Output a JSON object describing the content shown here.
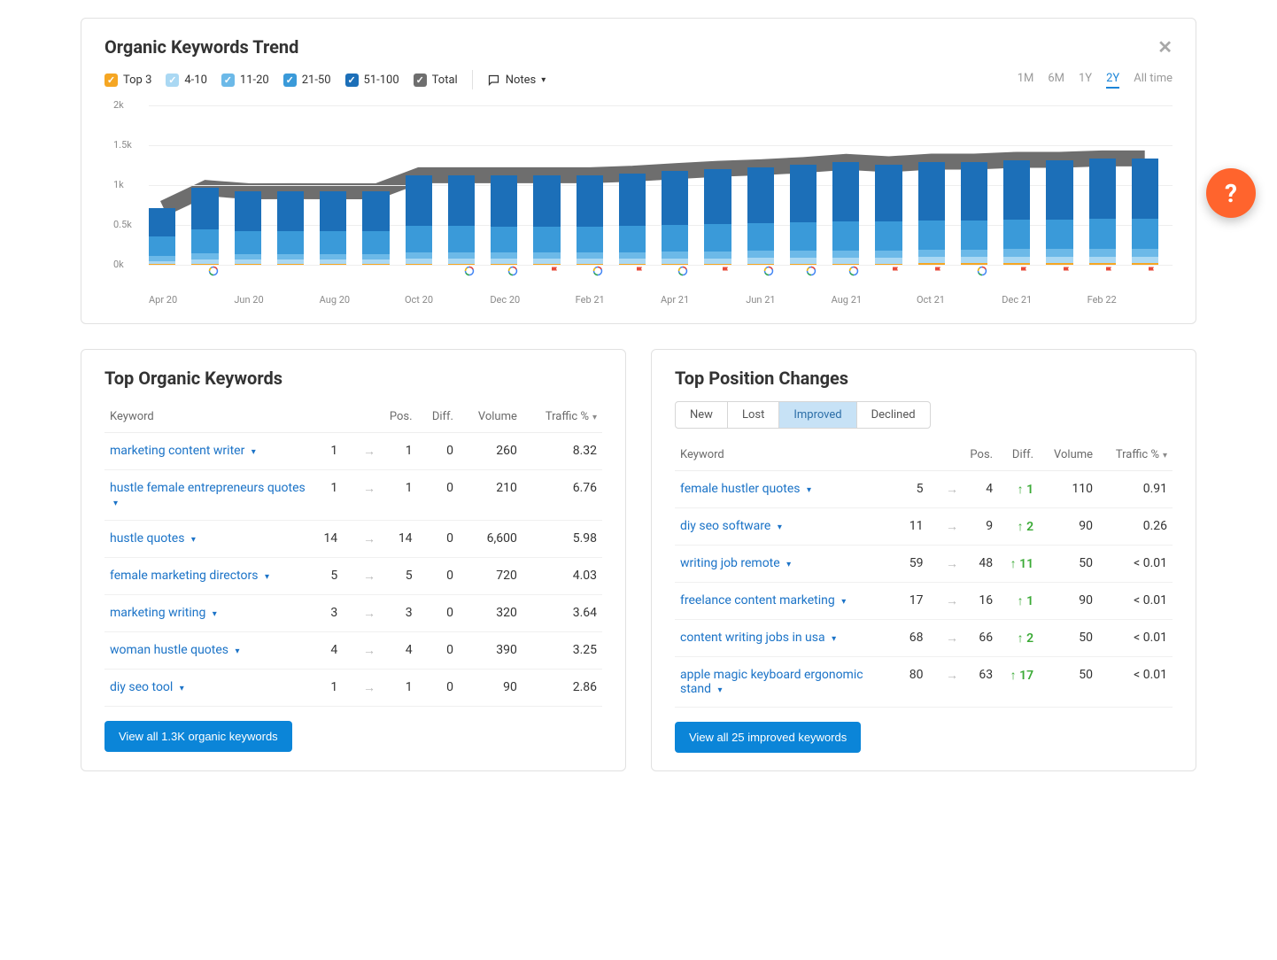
{
  "trend_card": {
    "title": "Organic Keywords Trend",
    "legend": {
      "top3": "Top 3",
      "r1": "4-10",
      "r2": "11-20",
      "r3": "21-50",
      "r4": "51-100",
      "total": "Total"
    },
    "notes_label": "Notes",
    "ranges": {
      "m1": "1M",
      "m6": "6M",
      "y1": "1Y",
      "y2": "2Y",
      "all": "All time"
    },
    "selected_range": "2Y"
  },
  "chart_data": {
    "type": "bar",
    "title": "Organic Keywords Trend",
    "ylabel": "",
    "xlabel": "",
    "ylim": [
      0,
      2000
    ],
    "yticks": [
      "0k",
      "0.5k",
      "1k",
      "1.5k",
      "2k"
    ],
    "categories": [
      "Apr 20",
      "May 20",
      "Jun 20",
      "Jul 20",
      "Aug 20",
      "Sep 20",
      "Oct 20",
      "Nov 20",
      "Dec 20",
      "Jan 21",
      "Feb 21",
      "Mar 21",
      "Apr 21",
      "May 21",
      "Jun 21",
      "Jul 21",
      "Aug 21",
      "Sep 21",
      "Oct 21",
      "Nov 21",
      "Dec 21",
      "Jan 22",
      "Feb 22",
      "Mar 22"
    ],
    "xticks_shown": [
      "Apr 20",
      "Jun 20",
      "Aug 20",
      "Oct 20",
      "Dec 20",
      "Feb 21",
      "Apr 21",
      "Jun 21",
      "Aug 21",
      "Oct 21",
      "Dec 21",
      "Feb 22"
    ],
    "series": [
      {
        "name": "Top 3",
        "values": [
          10,
          13,
          12,
          13,
          12,
          12,
          14,
          14,
          13,
          13,
          13,
          14,
          15,
          15,
          15,
          15,
          16,
          16,
          17,
          17,
          18,
          18,
          18,
          18
        ]
      },
      {
        "name": "4-10",
        "values": [
          40,
          55,
          50,
          50,
          50,
          50,
          60,
          60,
          60,
          60,
          60,
          62,
          65,
          68,
          70,
          72,
          75,
          75,
          80,
          80,
          85,
          85,
          86,
          86
        ]
      },
      {
        "name": "11-20",
        "values": [
          60,
          75,
          70,
          70,
          70,
          70,
          80,
          80,
          80,
          80,
          80,
          82,
          85,
          86,
          88,
          90,
          90,
          90,
          92,
          92,
          94,
          94,
          96,
          96
        ]
      },
      {
        "name": "21-50",
        "values": [
          250,
          300,
          290,
          290,
          290,
          290,
          330,
          330,
          330,
          330,
          330,
          335,
          340,
          345,
          350,
          355,
          360,
          360,
          365,
          365,
          370,
          370,
          375,
          375
        ]
      },
      {
        "name": "51-100",
        "values": [
          350,
          520,
          500,
          500,
          500,
          500,
          640,
          640,
          640,
          640,
          640,
          650,
          670,
          690,
          700,
          720,
          750,
          720,
          740,
          740,
          750,
          750,
          760,
          760
        ]
      }
    ],
    "total": [
      710,
      963,
      922,
      923,
      922,
      922,
      1124,
      1124,
      1123,
      1123,
      1123,
      1143,
      1175,
      1204,
      1223,
      1252,
      1291,
      1261,
      1294,
      1294,
      1317,
      1317,
      1335,
      1335
    ],
    "markers": {
      "google": [
        1,
        7,
        8,
        10,
        12,
        14,
        15,
        16,
        19
      ],
      "flag": [
        9,
        11,
        13,
        17,
        18,
        20,
        21,
        22,
        23
      ]
    }
  },
  "organic": {
    "title": "Top Organic Keywords",
    "columns": {
      "kw": "Keyword",
      "pos": "Pos.",
      "diff": "Diff.",
      "vol": "Volume",
      "traf": "Traffic %"
    },
    "rows": [
      {
        "kw": "marketing content writer",
        "from": 1,
        "to": 1,
        "diff": 0,
        "vol": "260",
        "traf": "8.32"
      },
      {
        "kw": "hustle female entrepreneurs quotes",
        "from": 1,
        "to": 1,
        "diff": 0,
        "vol": "210",
        "traf": "6.76"
      },
      {
        "kw": "hustle quotes",
        "from": 14,
        "to": 14,
        "diff": 0,
        "vol": "6,600",
        "traf": "5.98"
      },
      {
        "kw": "female marketing directors",
        "from": 5,
        "to": 5,
        "diff": 0,
        "vol": "720",
        "traf": "4.03"
      },
      {
        "kw": "marketing writing",
        "from": 3,
        "to": 3,
        "diff": 0,
        "vol": "320",
        "traf": "3.64"
      },
      {
        "kw": "woman hustle quotes",
        "from": 4,
        "to": 4,
        "diff": 0,
        "vol": "390",
        "traf": "3.25"
      },
      {
        "kw": "diy seo tool",
        "from": 1,
        "to": 1,
        "diff": 0,
        "vol": "90",
        "traf": "2.86"
      }
    ],
    "button": "View all 1.3K organic keywords"
  },
  "changes": {
    "title": "Top Position Changes",
    "tabs": {
      "new": "New",
      "lost": "Lost",
      "imp": "Improved",
      "dec": "Declined"
    },
    "selected_tab": "Improved",
    "columns": {
      "kw": "Keyword",
      "pos": "Pos.",
      "diff": "Diff.",
      "vol": "Volume",
      "traf": "Traffic %"
    },
    "rows": [
      {
        "kw": "female hustler quotes",
        "from": 5,
        "to": 4,
        "diff": 1,
        "vol": "110",
        "traf": "0.91"
      },
      {
        "kw": "diy seo software",
        "from": 11,
        "to": 9,
        "diff": 2,
        "vol": "90",
        "traf": "0.26"
      },
      {
        "kw": "writing job remote",
        "from": 59,
        "to": 48,
        "diff": 11,
        "vol": "50",
        "traf": "< 0.01"
      },
      {
        "kw": "freelance content marketing",
        "from": 17,
        "to": 16,
        "diff": 1,
        "vol": "90",
        "traf": "< 0.01"
      },
      {
        "kw": "content writing jobs in usa",
        "from": 68,
        "to": 66,
        "diff": 2,
        "vol": "50",
        "traf": "< 0.01"
      },
      {
        "kw": "apple magic keyboard ergonomic stand",
        "from": 80,
        "to": 63,
        "diff": 17,
        "vol": "50",
        "traf": "< 0.01"
      }
    ],
    "button": "View all 25 improved keywords"
  }
}
